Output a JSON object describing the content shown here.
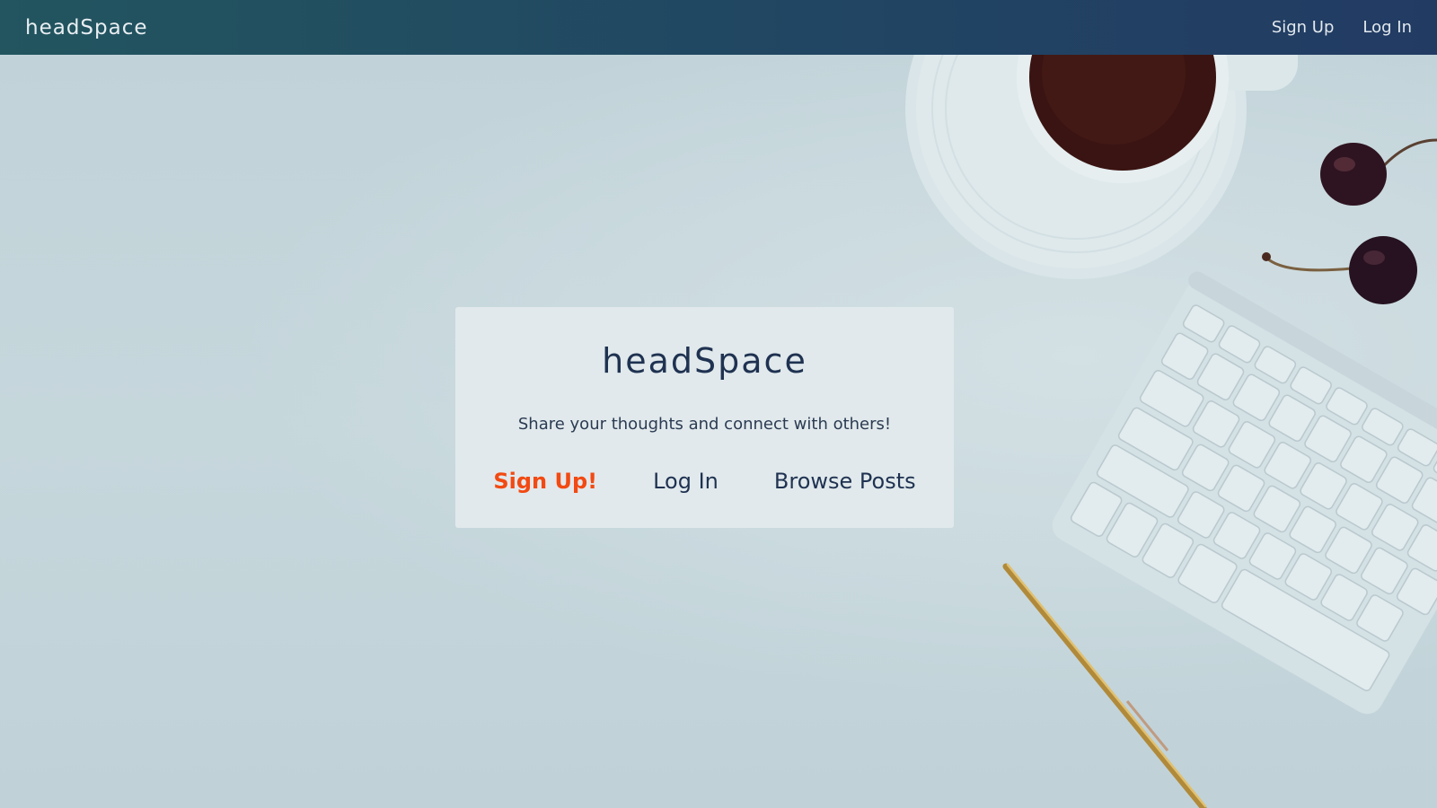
{
  "navbar": {
    "brand": "headSpace",
    "links": [
      {
        "label": "Sign Up"
      },
      {
        "label": "Log In"
      }
    ]
  },
  "hero": {
    "title": "headSpace",
    "subtitle": "Share your thoughts and connect with others!",
    "actions": [
      {
        "label": "Sign Up!",
        "style": "primary"
      },
      {
        "label": "Log In"
      },
      {
        "label": "Browse Posts"
      }
    ]
  },
  "colors": {
    "accent": "#f24a12",
    "navy": "#1f3251",
    "navbar_start": "#22555f",
    "navbar_end": "#223b63"
  },
  "background": {
    "objects": [
      "coffee-cup-icon",
      "cherries-icon",
      "keyboard-icon",
      "pen-icon"
    ]
  }
}
